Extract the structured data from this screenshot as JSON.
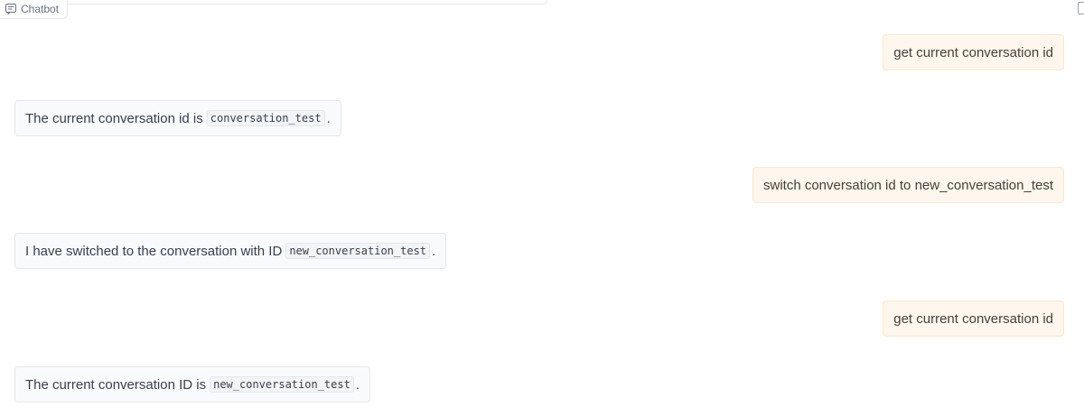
{
  "panel": {
    "label": "Chatbot",
    "icon": "chat-icon"
  },
  "messages": [
    {
      "role": "user",
      "text": "get current conversation id"
    },
    {
      "role": "bot",
      "prefix": "The current conversation id is",
      "code": "conversation_test",
      "suffix": "."
    },
    {
      "role": "user",
      "text": "switch conversation id to new_conversation_test"
    },
    {
      "role": "bot",
      "prefix": "I have switched to the conversation with ID",
      "code": "new_conversation_test",
      "suffix": "."
    },
    {
      "role": "user",
      "text": "get current conversation id"
    },
    {
      "role": "bot",
      "prefix": "The current conversation ID is",
      "code": "new_conversation_test",
      "suffix": "."
    }
  ],
  "colors": {
    "user_bubble": "#fff7ed",
    "bot_bubble": "#f9fafb",
    "border": "#e5e7eb"
  }
}
